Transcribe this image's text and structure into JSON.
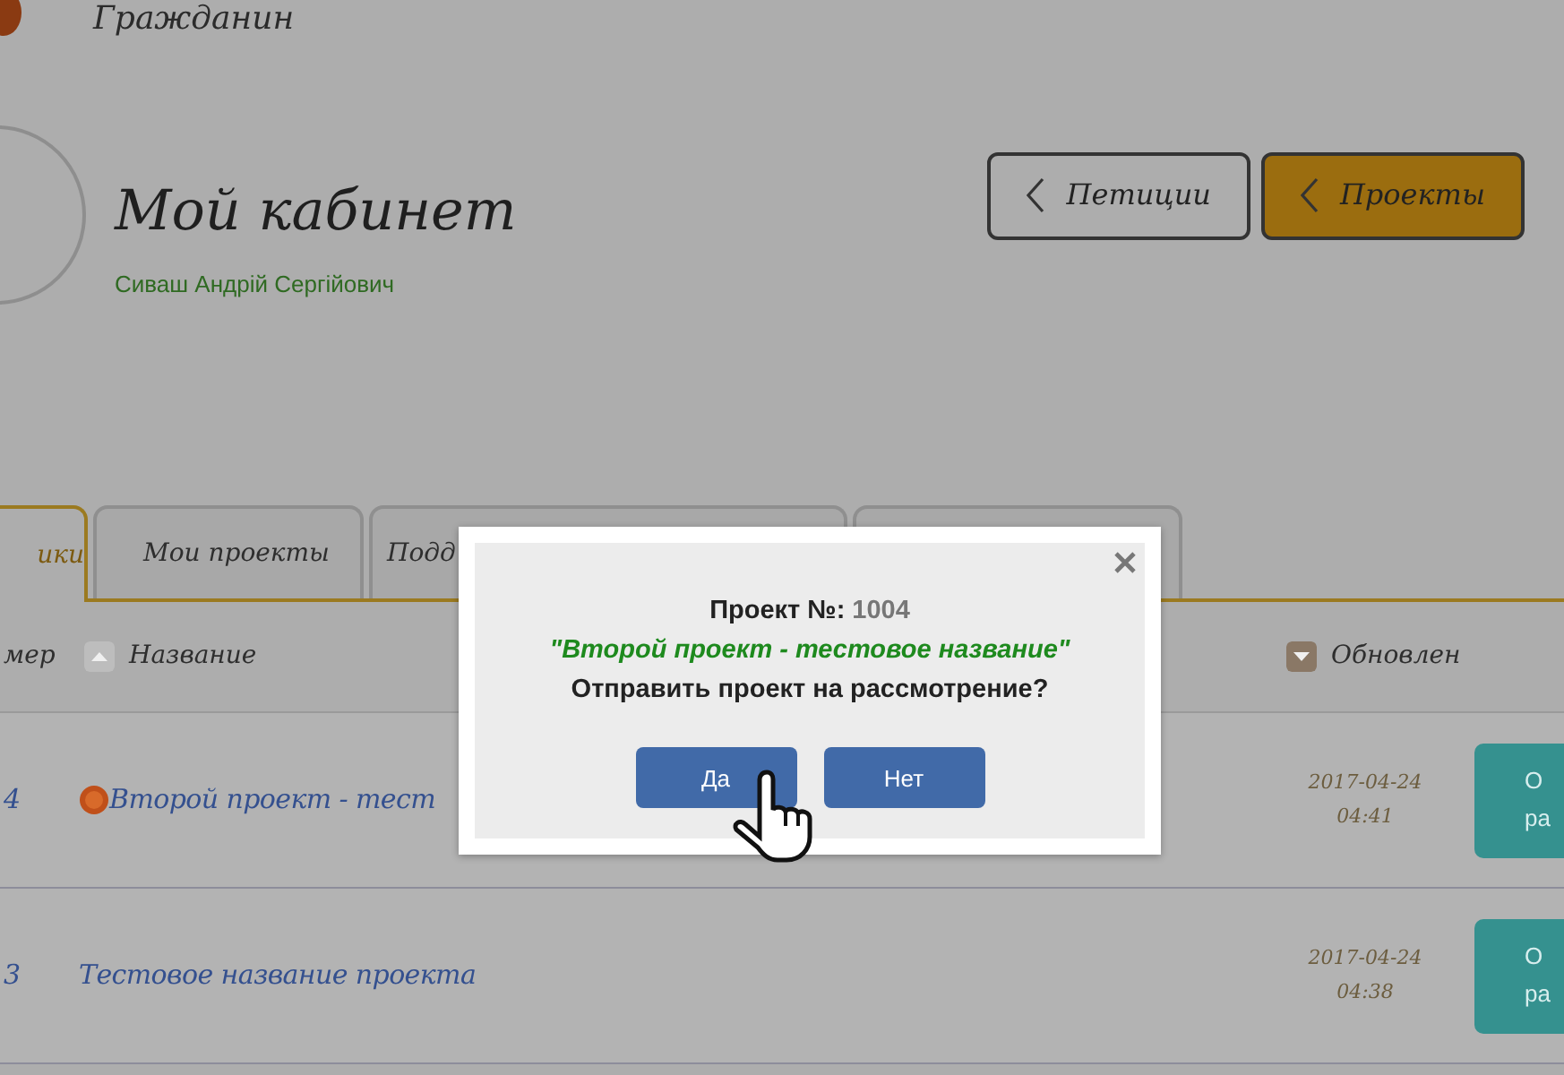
{
  "header": {
    "site_name": "Гражданин"
  },
  "profile": {
    "title": "Мой кабинет",
    "user_name": "Сиваш Андрій Сергійович"
  },
  "nav_buttons": [
    {
      "label": "Петиции",
      "selected": false
    },
    {
      "label": "Проекты",
      "selected": true
    }
  ],
  "tabs": [
    {
      "label": "ики",
      "selected": true
    },
    {
      "label": "Мои проекты",
      "selected": false
    },
    {
      "label": "Подд",
      "selected": false
    },
    {
      "selected": false
    }
  ],
  "columns": [
    {
      "label": "мер"
    },
    {
      "label": "Название",
      "sort_active": false
    },
    {
      "label": "Обновлен",
      "sort_active": true
    }
  ],
  "rows": [
    {
      "number": "4",
      "is_new": true,
      "title": "Второй проект - тест",
      "date": "2017-04-24",
      "time": "04:41",
      "action_lines": [
        "О",
        "ра"
      ]
    },
    {
      "number": "3",
      "is_new": false,
      "title": "Тестовое название проекта",
      "date": "2017-04-24",
      "time": "04:38",
      "action_lines": [
        "О",
        "ра"
      ]
    }
  ],
  "dialog": {
    "project_label": "Проект №:",
    "project_number": "1004",
    "project_name": "\"Второй проект - тестовое название\"",
    "question": "Отправить проект на рассмотрение?",
    "buttons": [
      {
        "label": "Да"
      },
      {
        "label": "Нет"
      }
    ]
  }
}
